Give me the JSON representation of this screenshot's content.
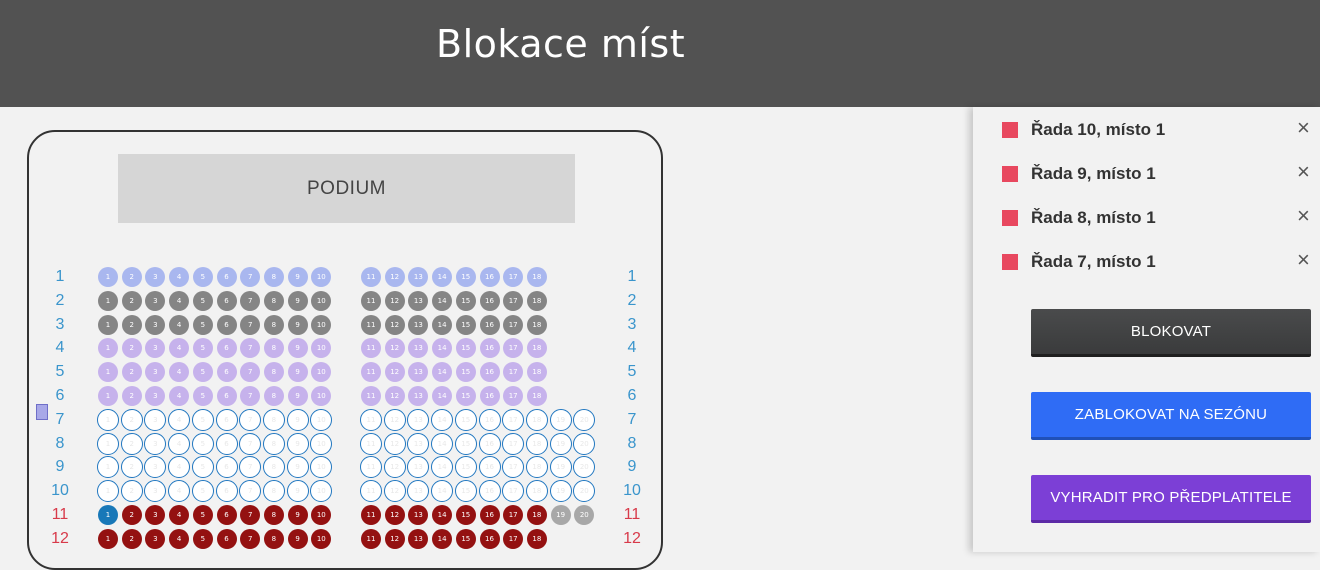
{
  "header": {
    "title": "Blokace míst"
  },
  "hall": {
    "podium_label": "PODIUM",
    "row_label_colors": {
      "blue": "#3a95cc",
      "red": "#d83a4a"
    },
    "seat_colors": {
      "lav": "#a9b7ef",
      "gray": "#858585",
      "lilac": "#c6b2ec",
      "outline": "#2177c0",
      "red": "#941111",
      "blue": "#1878b8",
      "lightgray": "#a8a8a8"
    },
    "rows": [
      {
        "label": "1",
        "label_color": "blue",
        "left": [
          "lav",
          18
        ],
        "right": []
      },
      {
        "label": "2",
        "label_color": "blue",
        "left": [
          "gray",
          18
        ],
        "right": []
      },
      {
        "label": "3",
        "label_color": "blue",
        "left": [
          "gray",
          18
        ],
        "right": []
      },
      {
        "label": "4",
        "label_color": "blue",
        "left": [
          "lilac",
          18
        ],
        "right": []
      },
      {
        "label": "5",
        "label_color": "blue",
        "left": [
          "lilac",
          18
        ],
        "right": []
      },
      {
        "label": "6",
        "label_color": "blue",
        "left": [
          "lilac",
          18
        ],
        "right": []
      },
      {
        "label": "7",
        "label_color": "blue",
        "left": [
          "outline",
          20
        ],
        "right": []
      },
      {
        "label": "8",
        "label_color": "blue",
        "left": [
          "outline",
          20
        ],
        "right": []
      },
      {
        "label": "9",
        "label_color": "blue",
        "left": [
          "outline",
          20
        ],
        "right": []
      },
      {
        "label": "10",
        "label_color": "blue",
        "left": [
          "outline",
          20
        ],
        "right": []
      },
      {
        "label": "11",
        "label_color": "red",
        "left": [
          "red",
          20
        ],
        "right": []
      },
      {
        "label": "12",
        "label_color": "red",
        "left": [
          "red",
          18
        ],
        "right": []
      }
    ],
    "row11_special": {
      "first_seat_style": "blue",
      "seats_19_20_style": "lightgray"
    }
  },
  "panel": {
    "swatch_color": "#e8485f",
    "selected_seats": [
      {
        "label": "Řada 10, místo 1"
      },
      {
        "label": "Řada 9, místo 1"
      },
      {
        "label": "Řada 8, místo 1"
      },
      {
        "label": "Řada 7, místo 1"
      }
    ],
    "close_icon": "×",
    "buttons": {
      "block": "BLOKOVAT",
      "season": "ZABLOKOVAT NA SEZÓNU",
      "subscribers": "VYHRADIT PRO PŘEDPLATITELE"
    }
  }
}
